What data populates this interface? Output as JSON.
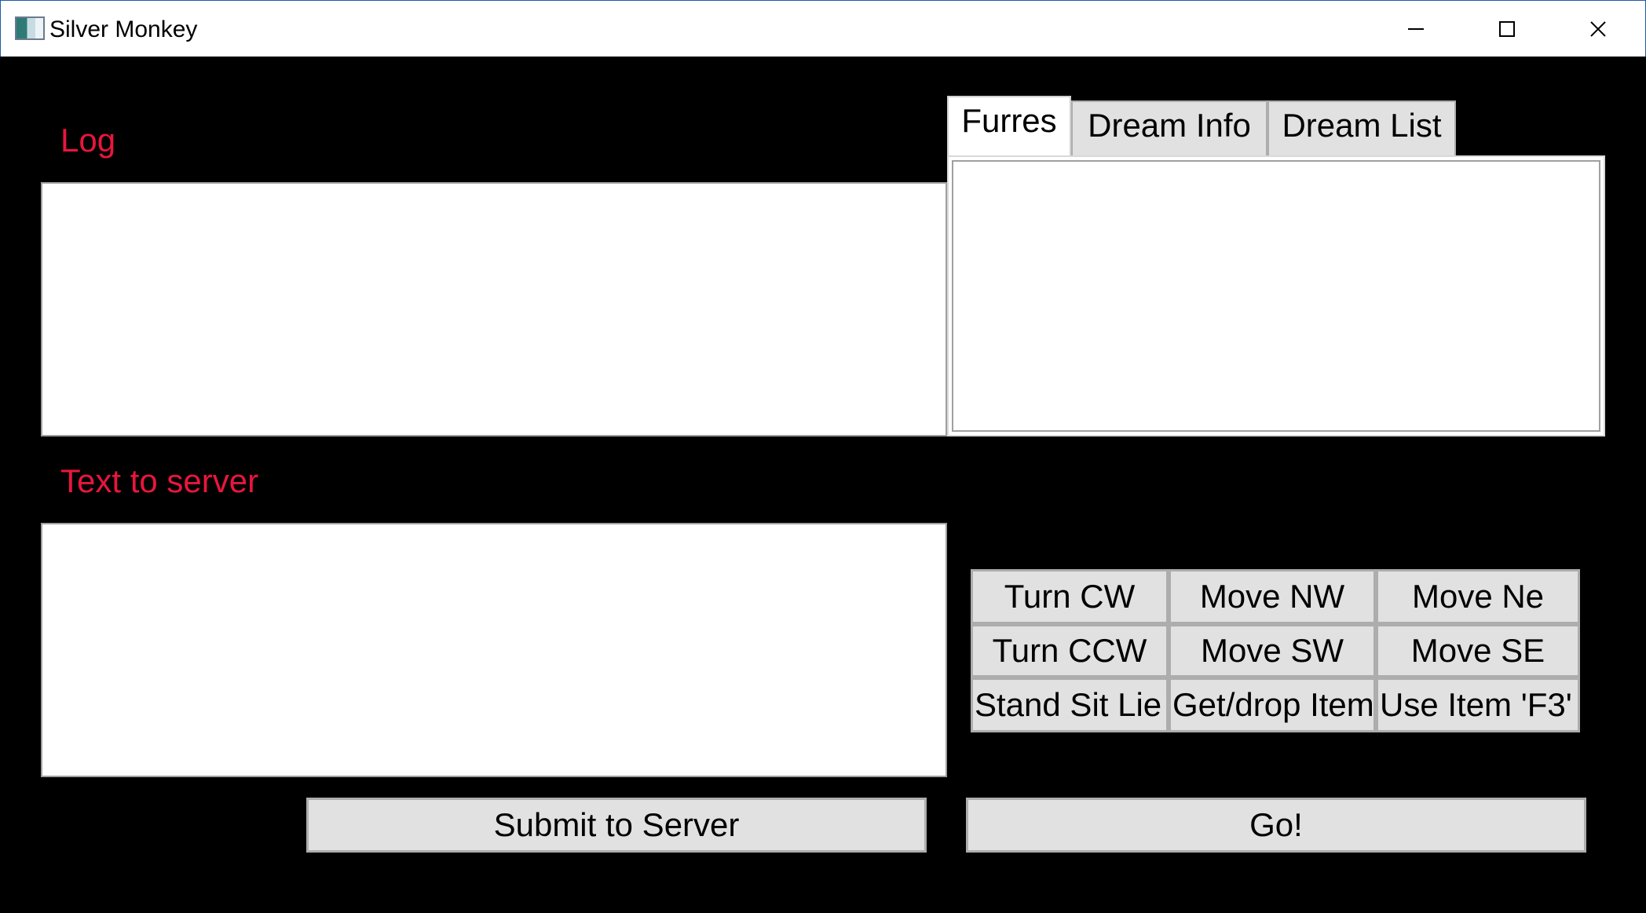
{
  "window": {
    "title": "Silver Monkey",
    "controls": {
      "minimize": "minimize-icon",
      "maximize": "maximize-icon",
      "close": "close-icon"
    }
  },
  "log": {
    "label": "Log",
    "value": ""
  },
  "text_to_server": {
    "label": "Text to server",
    "value": ""
  },
  "tabs": [
    {
      "label": "Furres",
      "selected": true
    },
    {
      "label": "Dream Info",
      "selected": false
    },
    {
      "label": "Dream List",
      "selected": false
    }
  ],
  "movement": {
    "rows": [
      [
        "Turn CW",
        "Move NW",
        "Move Ne"
      ],
      [
        "Turn CCW",
        "Move SW",
        "Move SE"
      ],
      [
        "Stand Sit Lie",
        "Get/drop Item",
        "Use Item 'F3'"
      ]
    ]
  },
  "actions": {
    "submit_label": "Submit to Server",
    "go_label": "Go!"
  },
  "colors": {
    "label_color": "#e8163c",
    "background": "#000000",
    "button_face": "#e1e1e1"
  }
}
